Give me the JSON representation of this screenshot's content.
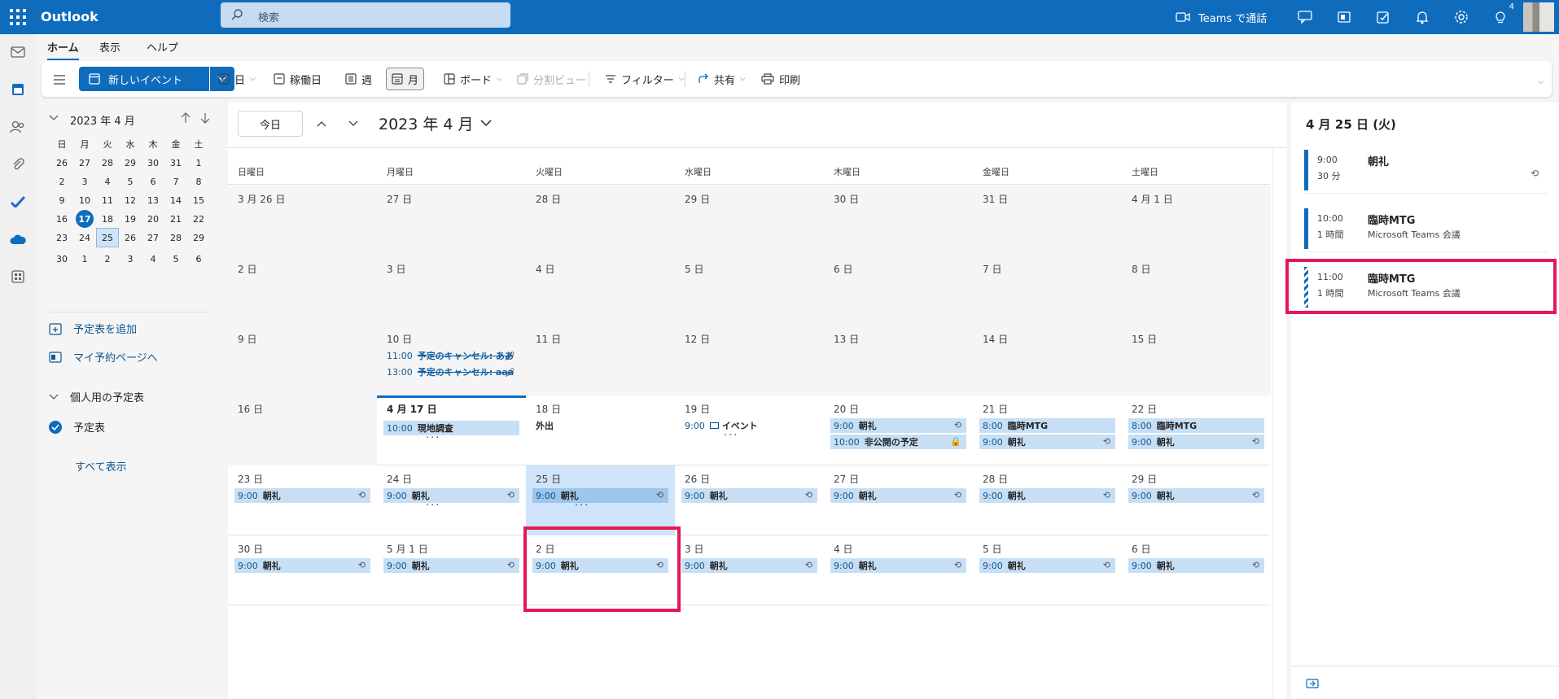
{
  "app": {
    "name": "Outlook"
  },
  "search": {
    "placeholder": "検索"
  },
  "topbar": {
    "teams_call": "Teams で通話",
    "tips_badge": "4"
  },
  "tabs": [
    "ホーム",
    "表示",
    "ヘルプ"
  ],
  "ribbon": {
    "new_event": "新しいイベント",
    "day": "日",
    "workweek": "稼働日",
    "week": "週",
    "month": "月",
    "board": "ボード",
    "split": "分割ビュー",
    "filter": "フィルター",
    "share": "共有",
    "print": "印刷"
  },
  "mini_calendar": {
    "title": "2023 年 4 月",
    "weekdays": [
      "日",
      "月",
      "火",
      "水",
      "木",
      "金",
      "土"
    ],
    "weeks": [
      [
        "26",
        "27",
        "28",
        "29",
        "30",
        "31",
        "1"
      ],
      [
        "2",
        "3",
        "4",
        "5",
        "6",
        "7",
        "8"
      ],
      [
        "9",
        "10",
        "11",
        "12",
        "13",
        "14",
        "15"
      ],
      [
        "16",
        "17",
        "18",
        "19",
        "20",
        "21",
        "22"
      ],
      [
        "23",
        "24",
        "25",
        "26",
        "27",
        "28",
        "29"
      ],
      [
        "30",
        "1",
        "2",
        "3",
        "4",
        "5",
        "6"
      ]
    ],
    "today": "17",
    "selected": "25"
  },
  "left_links": {
    "add_calendar": "予定表を追加",
    "booking": "マイ予約ページへ",
    "group": "個人用の予定表",
    "calendar": "予定表",
    "show_all": "すべて表示"
  },
  "calendar": {
    "today_button": "今日",
    "title": "2023 年 4 月",
    "weekdays": [
      "日曜日",
      "月曜日",
      "火曜日",
      "水曜日",
      "木曜日",
      "金曜日",
      "土曜日"
    ],
    "weeks": [
      {
        "days": [
          {
            "label": "3 月 26 日",
            "muted": true,
            "events": []
          },
          {
            "label": "27 日",
            "muted": true,
            "events": []
          },
          {
            "label": "28 日",
            "muted": true,
            "events": []
          },
          {
            "label": "29 日",
            "muted": true,
            "events": []
          },
          {
            "label": "30 日",
            "muted": true,
            "events": []
          },
          {
            "label": "31 日",
            "muted": true,
            "events": []
          },
          {
            "label": "4 月 1 日",
            "muted": true,
            "events": []
          }
        ]
      },
      {
        "days": [
          {
            "label": "2 日",
            "muted": true,
            "events": []
          },
          {
            "label": "3 日",
            "muted": true,
            "events": []
          },
          {
            "label": "4 日",
            "muted": true,
            "events": []
          },
          {
            "label": "5 日",
            "muted": true,
            "events": []
          },
          {
            "label": "6 日",
            "muted": true,
            "events": []
          },
          {
            "label": "7 日",
            "muted": true,
            "events": []
          },
          {
            "label": "8 日",
            "muted": true,
            "events": []
          }
        ]
      },
      {
        "days": [
          {
            "label": "9 日",
            "muted": true,
            "events": []
          },
          {
            "label": "10 日",
            "muted": true,
            "events": [
              {
                "time": "11:00",
                "title": "予定のキャンセル: ああ",
                "style": "cancelled",
                "icon": "🖉"
              },
              {
                "time": "13:00",
                "title": "予定のキャンセル: aaa",
                "style": "cancelled",
                "icon": "🖉"
              }
            ]
          },
          {
            "label": "11 日",
            "muted": true,
            "events": []
          },
          {
            "label": "12 日",
            "muted": true,
            "events": []
          },
          {
            "label": "13 日",
            "muted": true,
            "events": []
          },
          {
            "label": "14 日",
            "muted": true,
            "events": []
          },
          {
            "label": "15 日",
            "muted": true,
            "events": []
          }
        ]
      },
      {
        "days": [
          {
            "label": "16 日",
            "muted": true,
            "events": []
          },
          {
            "label": "4 月 17 日",
            "today": true,
            "events": [
              {
                "time": "10:00",
                "title": "現地調査",
                "style": "fill"
              }
            ],
            "more": "···"
          },
          {
            "label": "18 日",
            "events": [
              {
                "time": "",
                "title": "外出",
                "style": "plain"
              }
            ]
          },
          {
            "label": "19 日",
            "events": [
              {
                "time": "9:00",
                "title": "イベント",
                "style": "plain",
                "box": true
              }
            ],
            "more": "···"
          },
          {
            "label": "20 日",
            "events": [
              {
                "time": "9:00",
                "title": "朝礼",
                "style": "fill",
                "icon": "⟲"
              },
              {
                "time": "10:00",
                "title": "非公開の予定",
                "style": "fill",
                "icon": "🔒"
              }
            ]
          },
          {
            "label": "21 日",
            "events": [
              {
                "time": "8:00",
                "title": "臨時MTG",
                "style": "fill"
              },
              {
                "time": "9:00",
                "title": "朝礼",
                "style": "fill",
                "icon": "⟲"
              }
            ]
          },
          {
            "label": "22 日",
            "events": [
              {
                "time": "8:00",
                "title": "臨時MTG",
                "style": "fill"
              },
              {
                "time": "9:00",
                "title": "朝礼",
                "style": "fill",
                "icon": "⟲"
              }
            ]
          }
        ]
      },
      {
        "days": [
          {
            "label": "23 日",
            "events": [
              {
                "time": "9:00",
                "title": "朝礼",
                "style": "fill",
                "icon": "⟲"
              }
            ]
          },
          {
            "label": "24 日",
            "events": [
              {
                "time": "9:00",
                "title": "朝礼",
                "style": "fill",
                "icon": "⟲"
              }
            ],
            "more": "···"
          },
          {
            "label": "25 日",
            "selected": true,
            "events": [
              {
                "time": "9:00",
                "title": "朝礼",
                "style": "fill dark",
                "icon": "⟲"
              }
            ],
            "more": "···"
          },
          {
            "label": "26 日",
            "events": [
              {
                "time": "9:00",
                "title": "朝礼",
                "style": "fill",
                "icon": "⟲"
              }
            ]
          },
          {
            "label": "27 日",
            "events": [
              {
                "time": "9:00",
                "title": "朝礼",
                "style": "fill",
                "icon": "⟲"
              }
            ]
          },
          {
            "label": "28 日",
            "events": [
              {
                "time": "9:00",
                "title": "朝礼",
                "style": "fill",
                "icon": "⟲"
              }
            ]
          },
          {
            "label": "29 日",
            "events": [
              {
                "time": "9:00",
                "title": "朝礼",
                "style": "fill",
                "icon": "⟲"
              }
            ]
          }
        ]
      },
      {
        "days": [
          {
            "label": "30 日",
            "events": [
              {
                "time": "9:00",
                "title": "朝礼",
                "style": "fill",
                "icon": "⟲"
              }
            ]
          },
          {
            "label": "5 月 1 日",
            "events": [
              {
                "time": "9:00",
                "title": "朝礼",
                "style": "fill",
                "icon": "⟲"
              }
            ]
          },
          {
            "label": "2 日",
            "events": [
              {
                "time": "9:00",
                "title": "朝礼",
                "style": "fill",
                "icon": "⟲"
              }
            ]
          },
          {
            "label": "3 日",
            "events": [
              {
                "time": "9:00",
                "title": "朝礼",
                "style": "fill",
                "icon": "⟲"
              }
            ]
          },
          {
            "label": "4 日",
            "events": [
              {
                "time": "9:00",
                "title": "朝礼",
                "style": "fill",
                "icon": "⟲"
              }
            ]
          },
          {
            "label": "5 日",
            "events": [
              {
                "time": "9:00",
                "title": "朝礼",
                "style": "fill",
                "icon": "⟲"
              }
            ]
          },
          {
            "label": "6 日",
            "events": [
              {
                "time": "9:00",
                "title": "朝礼",
                "style": "fill",
                "icon": "⟲"
              }
            ]
          }
        ]
      }
    ]
  },
  "agenda": {
    "title": "4 月 25 日 (火)",
    "events": [
      {
        "time": "9:00",
        "duration": "30 分",
        "title": "朝礼",
        "subtitle": "",
        "recurring": "⟲",
        "tentative": false
      },
      {
        "time": "10:00",
        "duration": "1 時間",
        "title": "臨時MTG",
        "subtitle": "Microsoft Teams 会議",
        "recurring": "",
        "tentative": false
      },
      {
        "time": "11:00",
        "duration": "1 時間",
        "title": "臨時MTG",
        "subtitle": "Microsoft Teams 会議",
        "recurring": "",
        "tentative": true
      }
    ]
  },
  "colors": {
    "brand": "#0f6cbd",
    "event_fill": "#c7dff5",
    "highlight": "#e5175a"
  }
}
